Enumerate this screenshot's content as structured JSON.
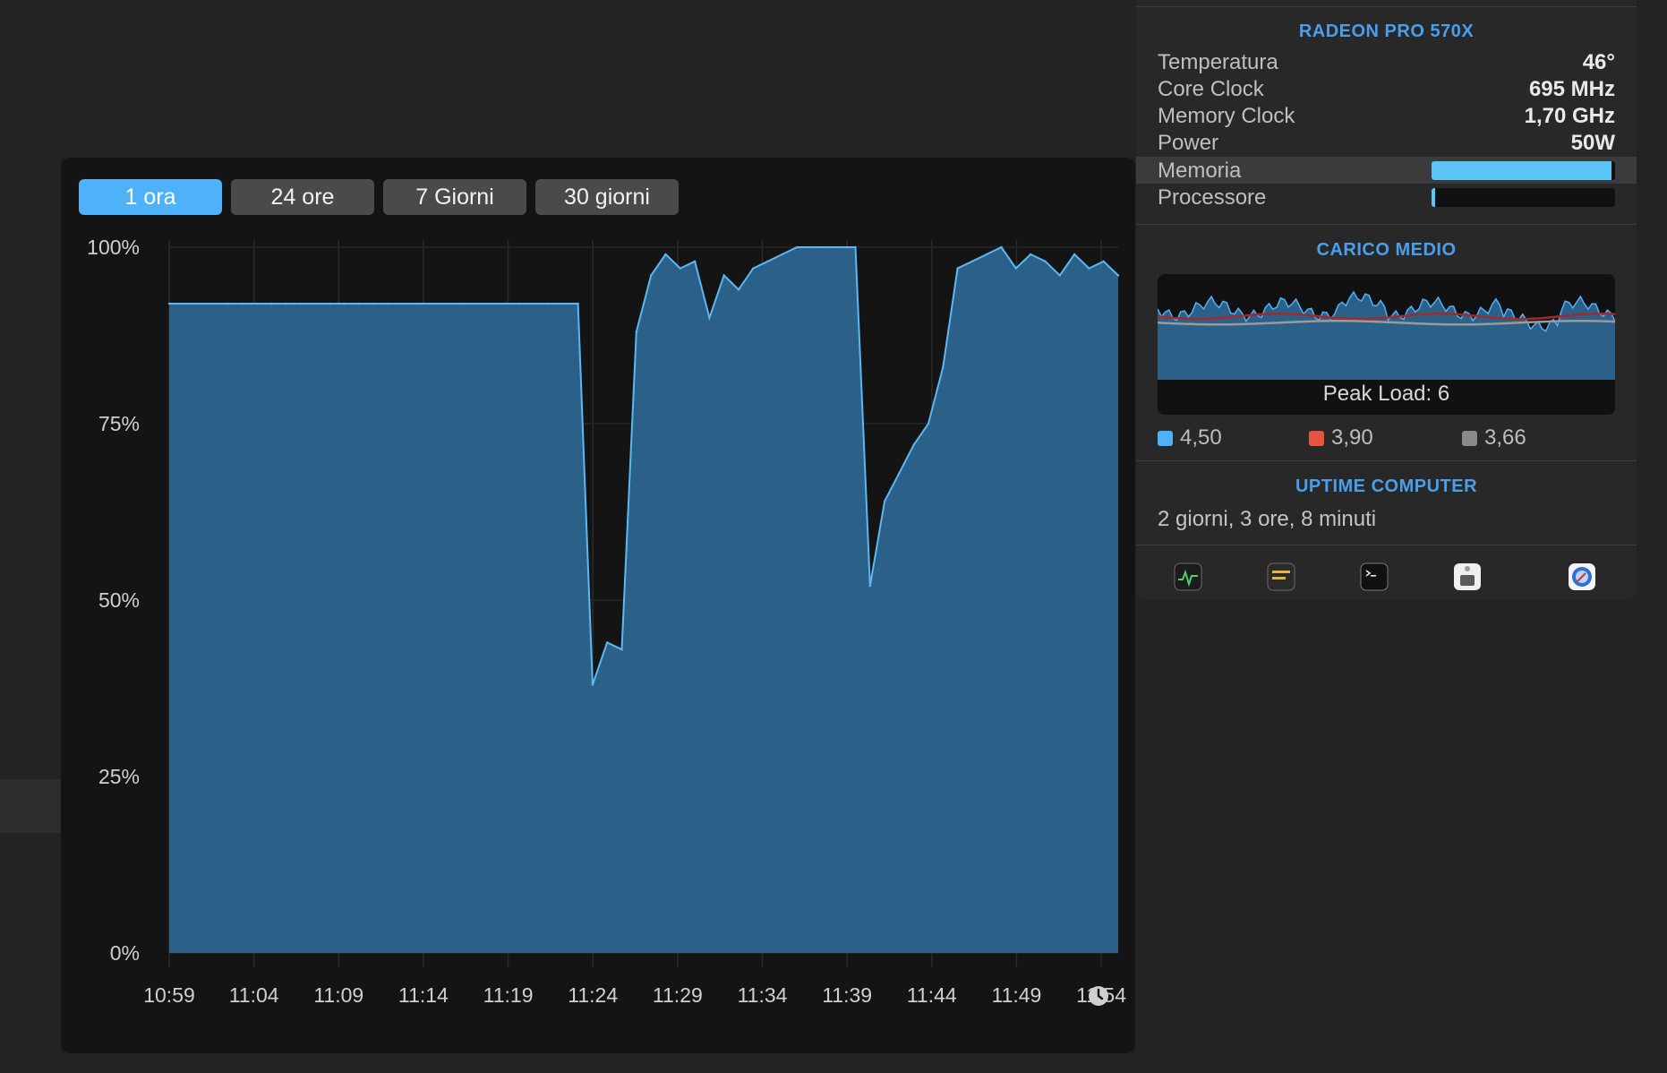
{
  "tabs": [
    {
      "label": "1 ora",
      "active": true
    },
    {
      "label": "24 ore",
      "active": false
    },
    {
      "label": "7 Giorni",
      "active": false
    },
    {
      "label": "30 giorni",
      "active": false
    }
  ],
  "chart_data": {
    "type": "area",
    "title": "",
    "xlabel": "",
    "ylabel": "",
    "yticks": [
      "100%",
      "75%",
      "50%",
      "25%",
      "0%"
    ],
    "ylim": [
      0,
      100
    ],
    "grid": true,
    "x_ticks": [
      "10:59",
      "11:04",
      "11:09",
      "11:14",
      "11:19",
      "11:24",
      "11:29",
      "11:34",
      "11:39",
      "11:44",
      "11:49",
      "11:54"
    ],
    "x": [
      "10:59",
      "11:00",
      "11:01",
      "11:02",
      "11:03",
      "11:04",
      "11:05",
      "11:06",
      "11:07",
      "11:08",
      "11:09",
      "11:10",
      "11:11",
      "11:12",
      "11:13",
      "11:14",
      "11:15",
      "11:16",
      "11:17",
      "11:18",
      "11:19",
      "11:20",
      "11:21",
      "11:22",
      "11:23",
      "11:24",
      "11:25",
      "11:26",
      "11:27",
      "11:27:30",
      "11:28",
      "11:28:30",
      "11:29",
      "11:29:30",
      "11:30",
      "11:31",
      "11:32",
      "11:33",
      "11:34",
      "11:35",
      "11:36",
      "11:37",
      "11:38",
      "11:39",
      "11:40",
      "11:41",
      "11:42",
      "11:43",
      "11:43:30",
      "11:44",
      "11:44:30",
      "11:45",
      "11:46",
      "11:47",
      "11:48",
      "11:49",
      "11:50",
      "11:51",
      "11:52",
      "11:53",
      "11:54",
      "11:55",
      "11:56",
      "11:57",
      "11:58",
      "11:59"
    ],
    "series": [
      {
        "values": [
          92,
          92,
          92,
          92,
          92,
          92,
          92,
          92,
          92,
          92,
          92,
          92,
          92,
          92,
          92,
          92,
          92,
          92,
          92,
          92,
          92,
          92,
          92,
          92,
          92,
          92,
          92,
          92,
          92,
          38,
          44,
          43,
          88,
          96,
          99,
          97,
          98,
          90,
          96,
          94,
          97,
          98,
          99,
          100,
          100,
          100,
          100,
          100,
          52,
          64,
          68,
          72,
          75,
          83,
          97,
          98,
          99,
          100,
          97,
          99,
          98,
          96,
          99,
          97,
          98,
          96
        ]
      }
    ],
    "fill_color": "#2b6188",
    "line_color": "#5bb8f5"
  },
  "gpu": {
    "title": "RADEON PRO 570X",
    "rows": [
      {
        "label": "Temperatura",
        "value": "46°"
      },
      {
        "label": "Core Clock",
        "value": "695 MHz"
      },
      {
        "label": "Memory Clock",
        "value": "1,70 GHz"
      },
      {
        "label": "Power",
        "value": "50W"
      }
    ],
    "memoria_label": "Memoria",
    "memoria_level": 0.98,
    "processore_label": "Processore",
    "processore_level": 0.02
  },
  "load": {
    "title": "CARICO MEDIO",
    "peak": "Peak Load: 6",
    "legend": [
      {
        "value": "4,50",
        "color": "#4fb1f7"
      },
      {
        "value": "3,90",
        "color": "#e5553f"
      },
      {
        "value": "3,66",
        "color": "#8a8a8a"
      }
    ],
    "bar_color": "#2b6188",
    "line1_color": "#a12a2a",
    "line2_color": "#9a9a9a"
  },
  "uptime": {
    "title": "UPTIME COMPUTER",
    "value": "2 giorni, 3 ore, 8 minuti"
  },
  "app_icons": [
    "activity-monitor-icon",
    "console-icon",
    "terminal-icon",
    "system-information-icon",
    "disk-utility-icon"
  ]
}
